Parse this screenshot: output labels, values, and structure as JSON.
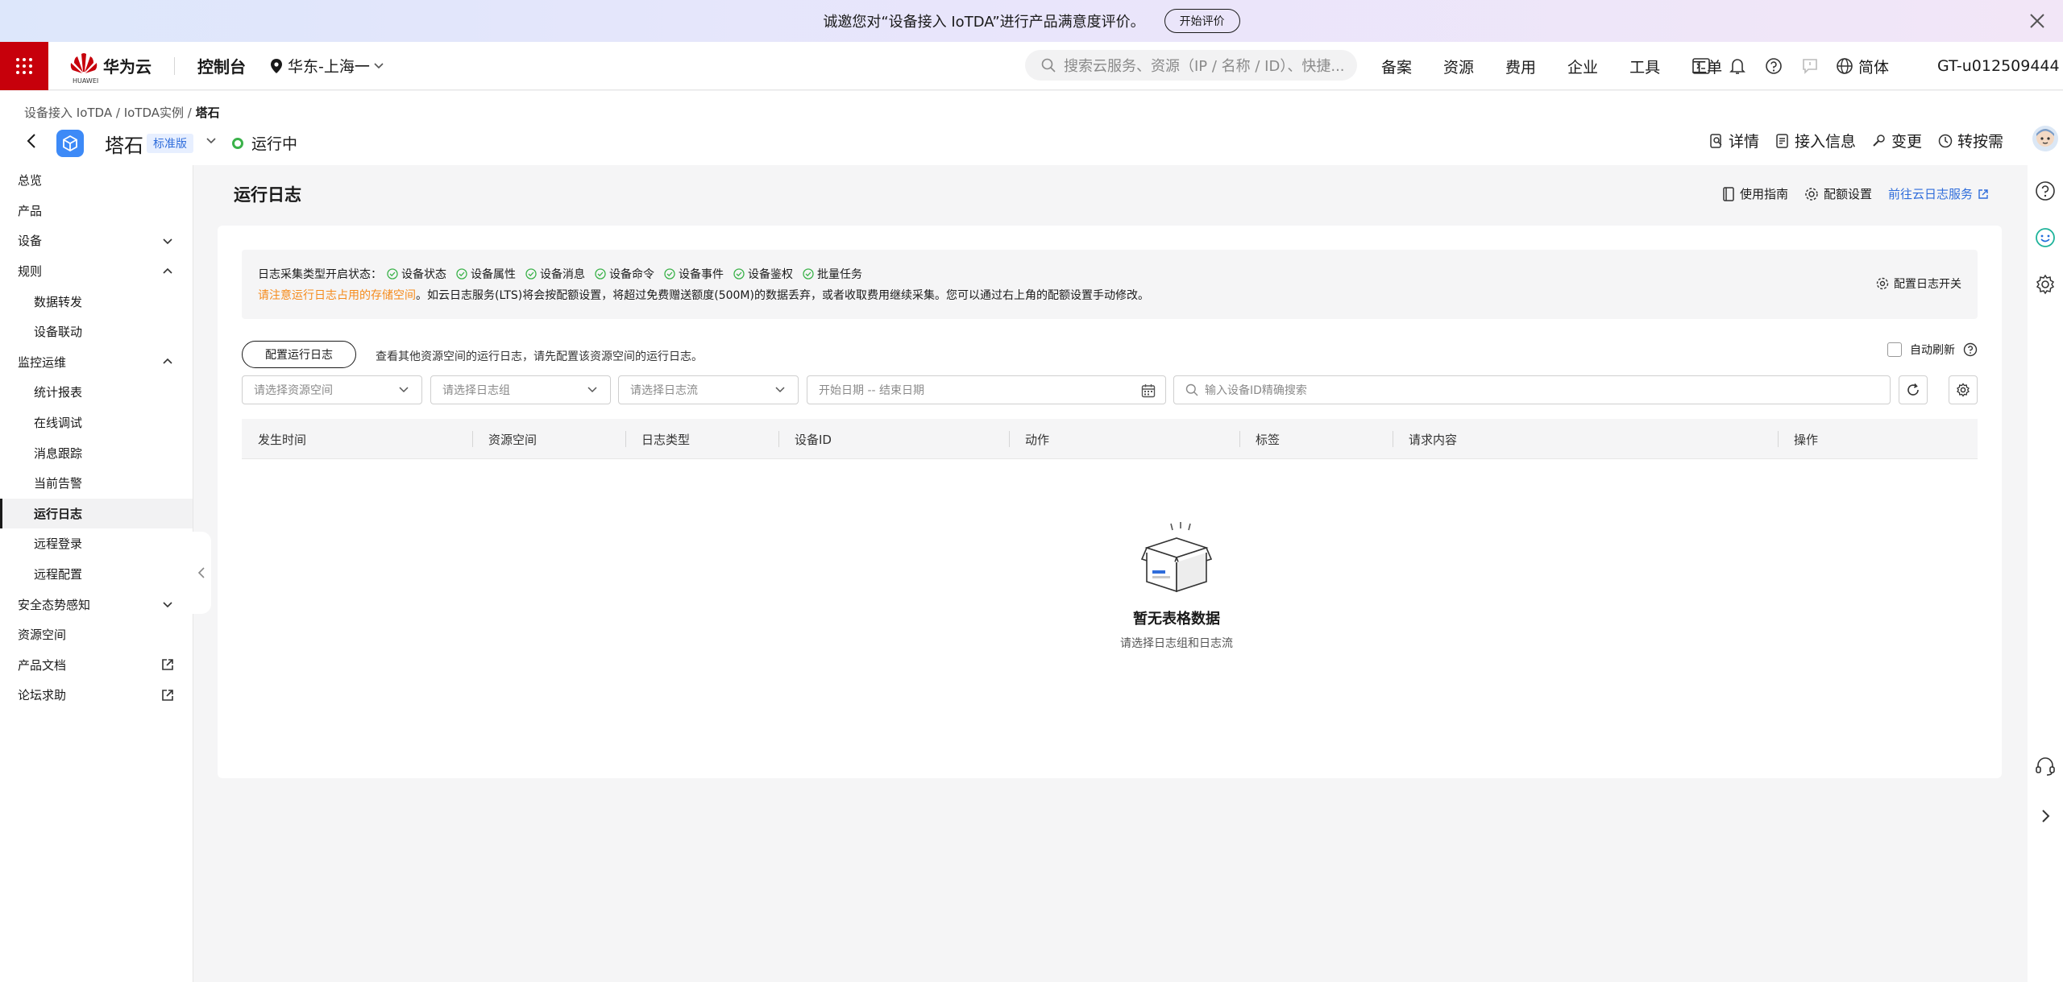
{
  "survey": {
    "text": "诚邀您对“设备接入 IoTDA”进行产品满意度评价。",
    "button": "开始评价"
  },
  "topbar": {
    "brand_sub": "HUAWEI",
    "brand": "华为云",
    "console": "控制台",
    "region": "华东-上海一",
    "search_placeholder": "搜索云服务、资源（IP / 名称 / ID）、快捷...",
    "menu": [
      "备案",
      "资源",
      "费用",
      "企业",
      "工具",
      "工单"
    ],
    "language": "简体",
    "account": "GT-u012509444"
  },
  "breadcrumb": {
    "items": [
      "设备接入 IoTDA",
      "IoTDA实例"
    ],
    "current": "塔石"
  },
  "instance": {
    "name": "塔石",
    "edition": "标准版",
    "status": "运行中",
    "actions": [
      "详情",
      "接入信息",
      "变更",
      "转按需"
    ]
  },
  "sidebar": {
    "items": [
      {
        "label": "总览",
        "level": 0,
        "caret": ""
      },
      {
        "label": "产品",
        "level": 0,
        "caret": ""
      },
      {
        "label": "设备",
        "level": 0,
        "caret": "down"
      },
      {
        "label": "规则",
        "level": 0,
        "caret": "up"
      },
      {
        "label": "数据转发",
        "level": 1,
        "caret": ""
      },
      {
        "label": "设备联动",
        "level": 1,
        "caret": ""
      },
      {
        "label": "监控运维",
        "level": 0,
        "caret": "up"
      },
      {
        "label": "统计报表",
        "level": 1,
        "caret": ""
      },
      {
        "label": "在线调试",
        "level": 1,
        "caret": ""
      },
      {
        "label": "消息跟踪",
        "level": 1,
        "caret": ""
      },
      {
        "label": "当前告警",
        "level": 1,
        "caret": ""
      },
      {
        "label": "运行日志",
        "level": 1,
        "caret": "",
        "active": true
      },
      {
        "label": "远程登录",
        "level": 1,
        "caret": ""
      },
      {
        "label": "远程配置",
        "level": 1,
        "caret": ""
      },
      {
        "label": "安全态势感知",
        "level": 0,
        "caret": "down"
      },
      {
        "label": "资源空间",
        "level": 0,
        "caret": ""
      },
      {
        "label": "产品文档",
        "level": 0,
        "caret": "external"
      },
      {
        "label": "论坛求助",
        "level": 0,
        "caret": "external"
      }
    ]
  },
  "page": {
    "title": "运行日志",
    "guide": "使用指南",
    "quota": "配额设置",
    "lts_link": "前往云日志服务"
  },
  "notice": {
    "label": "日志采集类型开启状态：",
    "types": [
      "设备状态",
      "设备属性",
      "设备消息",
      "设备命令",
      "设备事件",
      "设备鉴权",
      "批量任务"
    ],
    "warn": "请注意运行日志占用的存储空间",
    "rest": "。如云日志服务(LTS)将会按配额设置，将超过免费赠送额度(500M)的数据丢弃，或者收取费用继续采集。您可以通过右上角的配额设置手动修改。",
    "switch": "配置日志开关"
  },
  "toolbar": {
    "config_button": "配置运行日志",
    "config_tip": "查看其他资源空间的运行日志，请先配置该资源空间的运行日志。",
    "auto_refresh": "自动刷新"
  },
  "filters": {
    "resource_space": "请选择资源空间",
    "log_group": "请选择日志组",
    "log_stream": "请选择日志流",
    "date_range": "开始日期 -- 结束日期",
    "device_search": "输入设备ID精确搜索"
  },
  "table": {
    "columns": [
      "发生时间",
      "资源空间",
      "日志类型",
      "设备ID",
      "动作",
      "标签",
      "请求内容",
      "操作"
    ]
  },
  "empty": {
    "title": "暂无表格数据",
    "subtitle": "请选择日志组和日志流"
  },
  "colors": {
    "brand_red": "#c7000b",
    "link_blue": "#2f6ddb",
    "warn_orange": "#f58b1c",
    "ok_green": "#3bb24a"
  }
}
